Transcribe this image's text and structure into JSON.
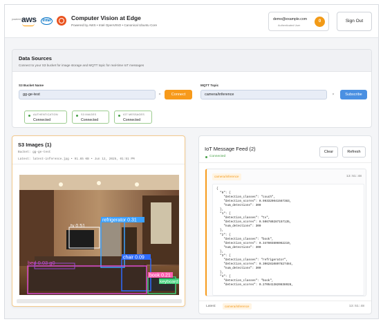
{
  "header": {
    "powered_by": "powered by",
    "aws_logo": "aws",
    "intel_logo": "intel",
    "title": "Computer Vision at Edge",
    "subtitle": "Powered by AWS • Intel OpenVINO • Canonical Ubuntu Core",
    "user_email": "demo@example.com",
    "user_role": "Authenticated User",
    "avatar_initial": "0",
    "sign_out_label": "Sign Out"
  },
  "data_sources": {
    "title": "Data Sources",
    "subtitle": "Connect to your S3 bucket for image storage and MQTT topic for real-time IoT messages",
    "bucket_label": "S3 Bucket Name",
    "bucket_value": "gg-ge-test",
    "clear_glyph": "×",
    "connect_label": "Connect",
    "topic_label": "MQTT Topic",
    "topic_value": "camera/inference",
    "subscribe_label": "Subscribe",
    "statuses": [
      {
        "label": "AUTHENTICATION",
        "value": "Connected"
      },
      {
        "label": "S3 IMAGES",
        "value": "Connected"
      },
      {
        "label": "IOT MESSAGES",
        "value": "Connected"
      }
    ]
  },
  "s3_images": {
    "title": "S3 Images (1)",
    "bucket": "Bucket: gg-ge-test",
    "latest": "Latest: latest-inference.jpg • 91.65 KB • Jun 12, 2025, 01:51 PM",
    "detections": [
      {
        "label": "refrigerator",
        "score": "0.31",
        "color": "#3aa0ff"
      },
      {
        "label": "tv",
        "score": "0.51",
        "color": "#ffffff"
      },
      {
        "label": "chair",
        "score": "0.09",
        "color": "#2e6bff"
      },
      {
        "label": "bed",
        "score": "0.03",
        "color": "#d94bd0"
      },
      {
        "label": "book",
        "score": "0.21",
        "color": "#ff5fb0"
      },
      {
        "label": "keyboard",
        "score": "",
        "color": "#3fd27a"
      }
    ]
  },
  "iot_feed": {
    "title": "IoT Message Feed (2)",
    "status": "Connected",
    "clear_label": "Clear",
    "refresh_label": "Refresh",
    "message_topic": "camera/inference",
    "message_time": "13:51:48",
    "payload": "{\n  \"0\": {\n    \"detection_classes\": \"couch\",\n    \"detection_scores\": 0.993329041567383,\n    \"num_detections\": 300\n  },\n  \"1\": {\n    \"detection_classes\": \"tv\",\n    \"detection_scores\": 0.506780287157135,\n    \"num_detections\": 300\n  },\n  \"2\": {\n    \"detection_classes\": \"book\",\n    \"detection_scores\": 0.347803806962219,\n    \"num_detections\": 300\n  },\n  \"3\": {\n    \"detection_classes\": \"refrigerator\",\n    \"detection_scores\": 0.3062810897827484,\n    \"num_detections\": 300\n  },\n  \"4\": {\n    \"detection_classes\": \"book\",\n    \"detection_scores\": 0.2705413820838928,",
    "footer_latest": "Latest:",
    "footer_topic": "camera/inference",
    "footer_time": "13:51:48"
  }
}
